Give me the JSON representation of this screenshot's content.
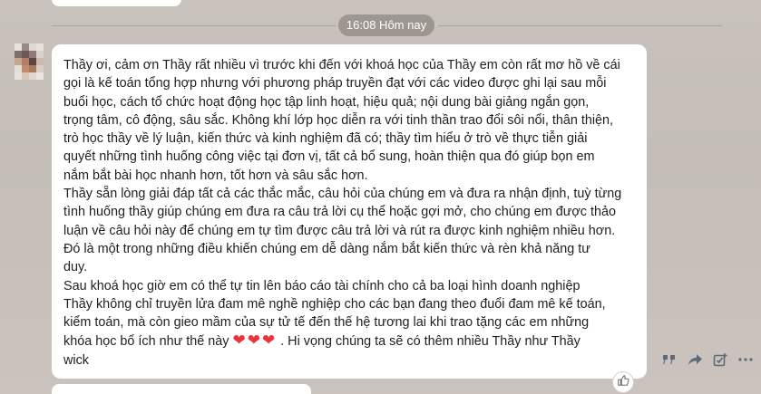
{
  "chat": {
    "time_divider": "16:08 Hôm nay",
    "message": {
      "lines": [
        "Thầy  ơi, cảm ơn Thầy rất nhiều vì trước khi đến với khoá học của Thầy em còn rất mơ hồ về cái",
        "gọi là kế toán tổng hợp nhưng với phương pháp truyền đạt với các video được ghi lại sau mỗi",
        "buổi học, cách tổ chức hoạt động học tập linh hoạt, hiệu quả; nội dung bài giảng ngắn gọn,",
        "trọng tâm, cô động, sâu sắc. Không khí lớp học diễn ra với tinh thần trao đổi sôi nổi, thân thiện,",
        "trò học thầy về lý luận, kiến thức và kinh nghiệm đã có; thầy tìm hiểu ở trò về thực tiễn giải",
        "quyết những tình huống công việc tại đơn vị, tất cả bổ sung, hoàn thiện qua đó giúp bọn em",
        "nắm bắt bài học nhanh hơn, tốt hơn và sâu sắc hơn.",
        "Thầy sẵn lòng giải đáp tất cả các thắc mắc, câu hỏi của chúng em và đưa ra nhận định, tuỳ từng",
        "tình huống thầy giúp chúng em đưa ra câu trả lời cụ thể hoặc gợi mở, cho chúng em được thảo",
        "luận về câu hỏi này để chúng em tự tìm được câu trả lời và rút ra được kinh nghiệm nhiều hơn.",
        "Đó là một trong những điều khiến chúng em dễ dàng nắm bắt kiến thức và rèn khả năng tư",
        "duy.",
        "Sau khoá học giờ em có thể tự tin lên báo cáo tài chính cho cả ba loại hình doanh nghiệp",
        "Thầy không chỉ truyền lửa đam mê nghề nghiệp cho các bạn đang theo đuổi đam mê kế toán,",
        "kiểm toán, mà còn gieo mầm của sự tử tế đến thế hệ tương lai khi trao tặng các em những"
      ],
      "emoji_line_before": "khóa học bổ ích như thế này ",
      "emoji_hearts": "❤❤❤",
      "emoji_line_after": " . Hi vọng chúng ta sẽ có thêm nhiều Thầy như Thầy",
      "last_line": "wick"
    },
    "actions": [
      "quote-icon",
      "forward-icon",
      "create-task-icon",
      "more-icon"
    ],
    "like_icon": "thumbs-up-icon",
    "heart_color": "#e8343a"
  }
}
